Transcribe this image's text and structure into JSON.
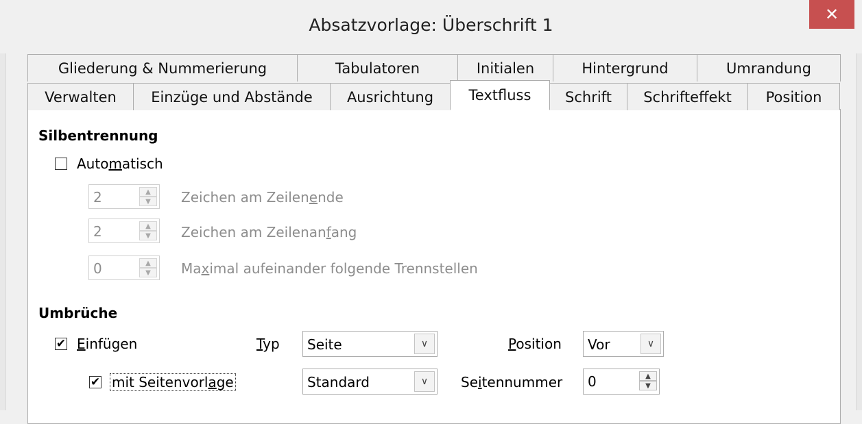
{
  "window": {
    "title": "Absatzvorlage: Überschrift 1",
    "close_glyph": "✕"
  },
  "tabs": {
    "row1": [
      "Gliederung & Nummerierung",
      "Tabulatoren",
      "Initialen",
      "Hintergrund",
      "Umrandung"
    ],
    "row2": [
      "Verwalten",
      "Einzüge und Abstände",
      "Ausrichtung",
      "Textfluss",
      "Schrift",
      "Schrifteffekt",
      "Position"
    ],
    "active": "Textfluss"
  },
  "hyphenation": {
    "heading": "Silbentrennung",
    "automatic_label": "Automatisch",
    "automatic_checked": false,
    "chars_line_end": {
      "value": "2",
      "label": "Zeichen am Zeilenende"
    },
    "chars_line_begin": {
      "value": "2",
      "label": "Zeichen am Zeilenanfang"
    },
    "max_consecutive": {
      "value": "0",
      "label": "Maximal aufeinander folgende Trennstellen"
    }
  },
  "breaks": {
    "heading": "Umbrüche",
    "insert_label": "Einfügen",
    "insert_checked": true,
    "type_label": "Typ",
    "type_value": "Seite",
    "position_label": "Position",
    "position_value": "Vor",
    "with_page_style_label": "mit Seitenvorlage",
    "with_page_style_checked": true,
    "page_style_value": "Standard",
    "page_number_label": "Seitennummer",
    "page_number_value": "0"
  },
  "icons": {
    "checkmark": "✔",
    "dropdown": "chevron-down-icon",
    "spin_up": "▲",
    "spin_down": "▼"
  },
  "colors": {
    "close_button": "#c75050",
    "disabled_text": "#8d8d8d"
  }
}
